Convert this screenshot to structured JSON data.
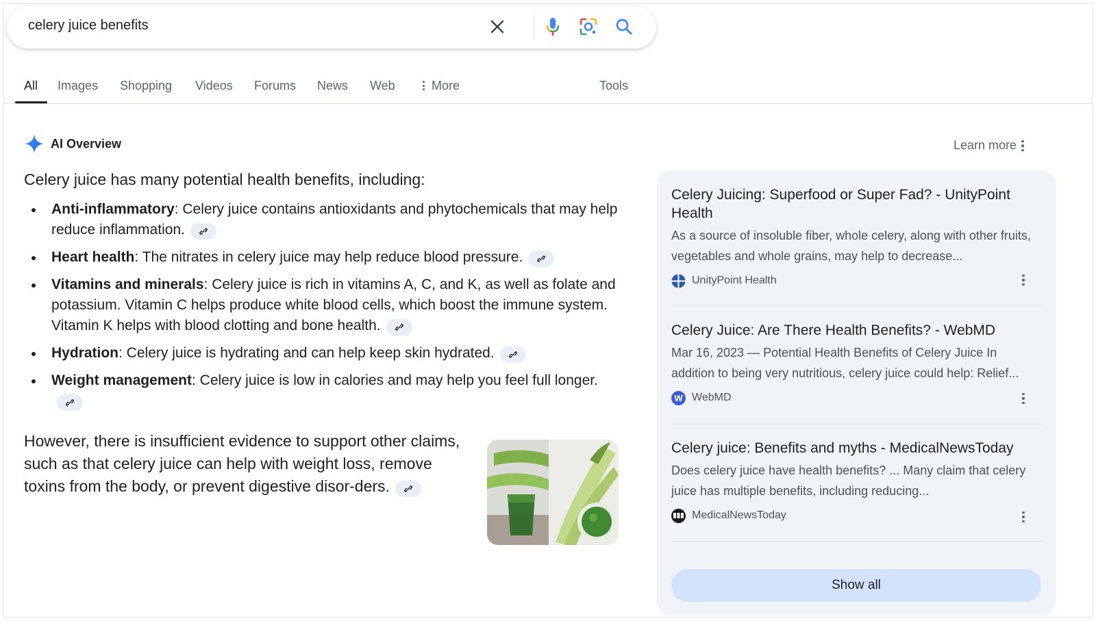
{
  "search": {
    "query": "celery juice benefits"
  },
  "tabs": [
    {
      "label": "All",
      "active": true
    },
    {
      "label": "Images"
    },
    {
      "label": "Shopping"
    },
    {
      "label": "Videos"
    },
    {
      "label": "Forums"
    },
    {
      "label": "News"
    },
    {
      "label": "Web"
    },
    {
      "label": "More"
    }
  ],
  "tools_label": "Tools",
  "ai_overview": {
    "title": "AI Overview",
    "learn_more": "Learn more",
    "intro": "Celery juice has many potential health benefits, including:",
    "bullets": [
      {
        "term": "Anti-inflammatory",
        "text": ": Celery juice contains antioxidants and phytochemicals that may help reduce inflammation."
      },
      {
        "term": "Heart health",
        "text": ": The nitrates in celery juice may help reduce blood pressure."
      },
      {
        "term": "Vitamins and minerals",
        "text": ": Celery juice is rich in vitamins A, C, and K, as well as folate and potassium. Vitamin C helps produce white blood cells, which boost the immune system. Vitamin K helps with blood clotting and bone health."
      },
      {
        "term": "Hydration",
        "text": ": Celery juice is hydrating and can help keep skin hydrated."
      },
      {
        "term": "Weight management",
        "text": ": Celery juice is low in calories and may help you feel full longer."
      }
    ],
    "however": "However, there is insufficient evidence to support other claims, such as that celery juice can help with weight loss, remove toxins from the body, or prevent digestive disor-ders."
  },
  "sources": [
    {
      "title": "Celery Juicing: Superfood or Super Fad? - UnityPoint Health",
      "snippet": "As a source of insoluble fiber, whole celery, along with other fruits, vegetables and whole grains, may help to decrease...",
      "site": "UnityPoint Health",
      "logo_color": "#2a5aa8"
    },
    {
      "title": "Celery Juice: Are There Health Benefits? - WebMD",
      "snippet": "Mar 16, 2023 — Potential Health Benefits of Celery Juice In addition to being very nutritious, celery juice could help: Relief...",
      "site": "WebMD",
      "logo_color": "#3d5bd9"
    },
    {
      "title": "Celery juice: Benefits and myths - MedicalNewsToday",
      "snippet": "Does celery juice have health benefits? ... Many claim that celery juice has multiple benefits, including reducing...",
      "site": "MedicalNewsToday",
      "logo_color": "#1a1a1a"
    }
  ],
  "show_all_label": "Show all",
  "colors": {
    "accent_blue": "#1a73e8",
    "panel_bg": "#f0f4f9",
    "show_all_bg": "#d3e3fd"
  }
}
